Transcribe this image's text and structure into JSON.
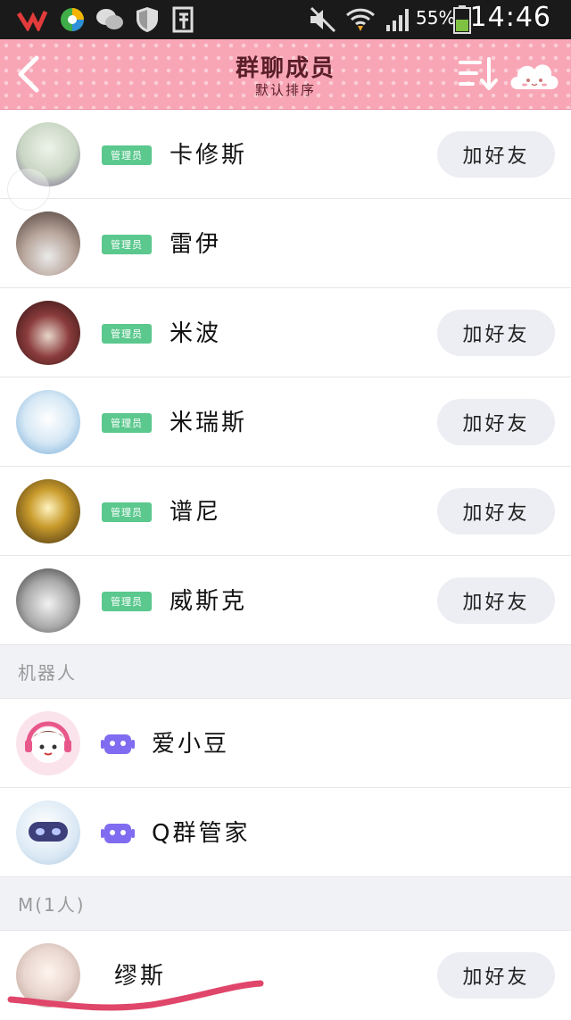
{
  "status_bar": {
    "battery_text": "55%",
    "time": "14:46",
    "icons": [
      "app-v-icon",
      "browser-icon",
      "wechat-icon",
      "shield-icon",
      "reader-icon",
      "mute-icon",
      "wifi-icon",
      "signal-icon",
      "battery-icon"
    ]
  },
  "header": {
    "title": "群聊成员",
    "subtitle": "默认排序",
    "back_icon": "chevron-left-icon",
    "sort_icon": "sort-icon",
    "more_icon": "cloud-icon"
  },
  "admins": [
    {
      "badge": "管理员",
      "name": "卡修斯",
      "button": "加好友",
      "has_button": true,
      "avatar_color": "#c9d6c4"
    },
    {
      "badge": "管理员",
      "name": "雷伊",
      "button": "",
      "has_button": false,
      "avatar_color": "#8b6f63"
    },
    {
      "badge": "管理员",
      "name": "米波",
      "button": "加好友",
      "has_button": true,
      "avatar_color": "#5a2525"
    },
    {
      "badge": "管理员",
      "name": "米瑞斯",
      "button": "加好友",
      "has_button": true,
      "avatar_color": "#bcd9ee"
    },
    {
      "badge": "管理员",
      "name": "谱尼",
      "button": "加好友",
      "has_button": true,
      "avatar_color": "#8a6a1f"
    },
    {
      "badge": "管理员",
      "name": "威斯克",
      "button": "加好友",
      "has_button": true,
      "avatar_color": "#9c9c9c"
    }
  ],
  "robots_section": {
    "label": "机器人",
    "robots": [
      {
        "name": "爱小豆",
        "avatar_color": "#f6c6d8",
        "icon": "robot-icon"
      },
      {
        "name": "Q群管家",
        "avatar_color": "#dbe9f5",
        "icon": "robot-icon"
      }
    ]
  },
  "m_section": {
    "label": "M(1人)",
    "members": [
      {
        "name": "缪斯",
        "button": "加好友",
        "avatar_color": "#e8d6cf"
      }
    ]
  },
  "colors": {
    "header_bg": "#f8a6b6",
    "badge_bg": "#5bc88e",
    "robot_icon": "#7f6cf0",
    "add_button_bg": "#eceef3",
    "scribble": "#e0456a"
  }
}
